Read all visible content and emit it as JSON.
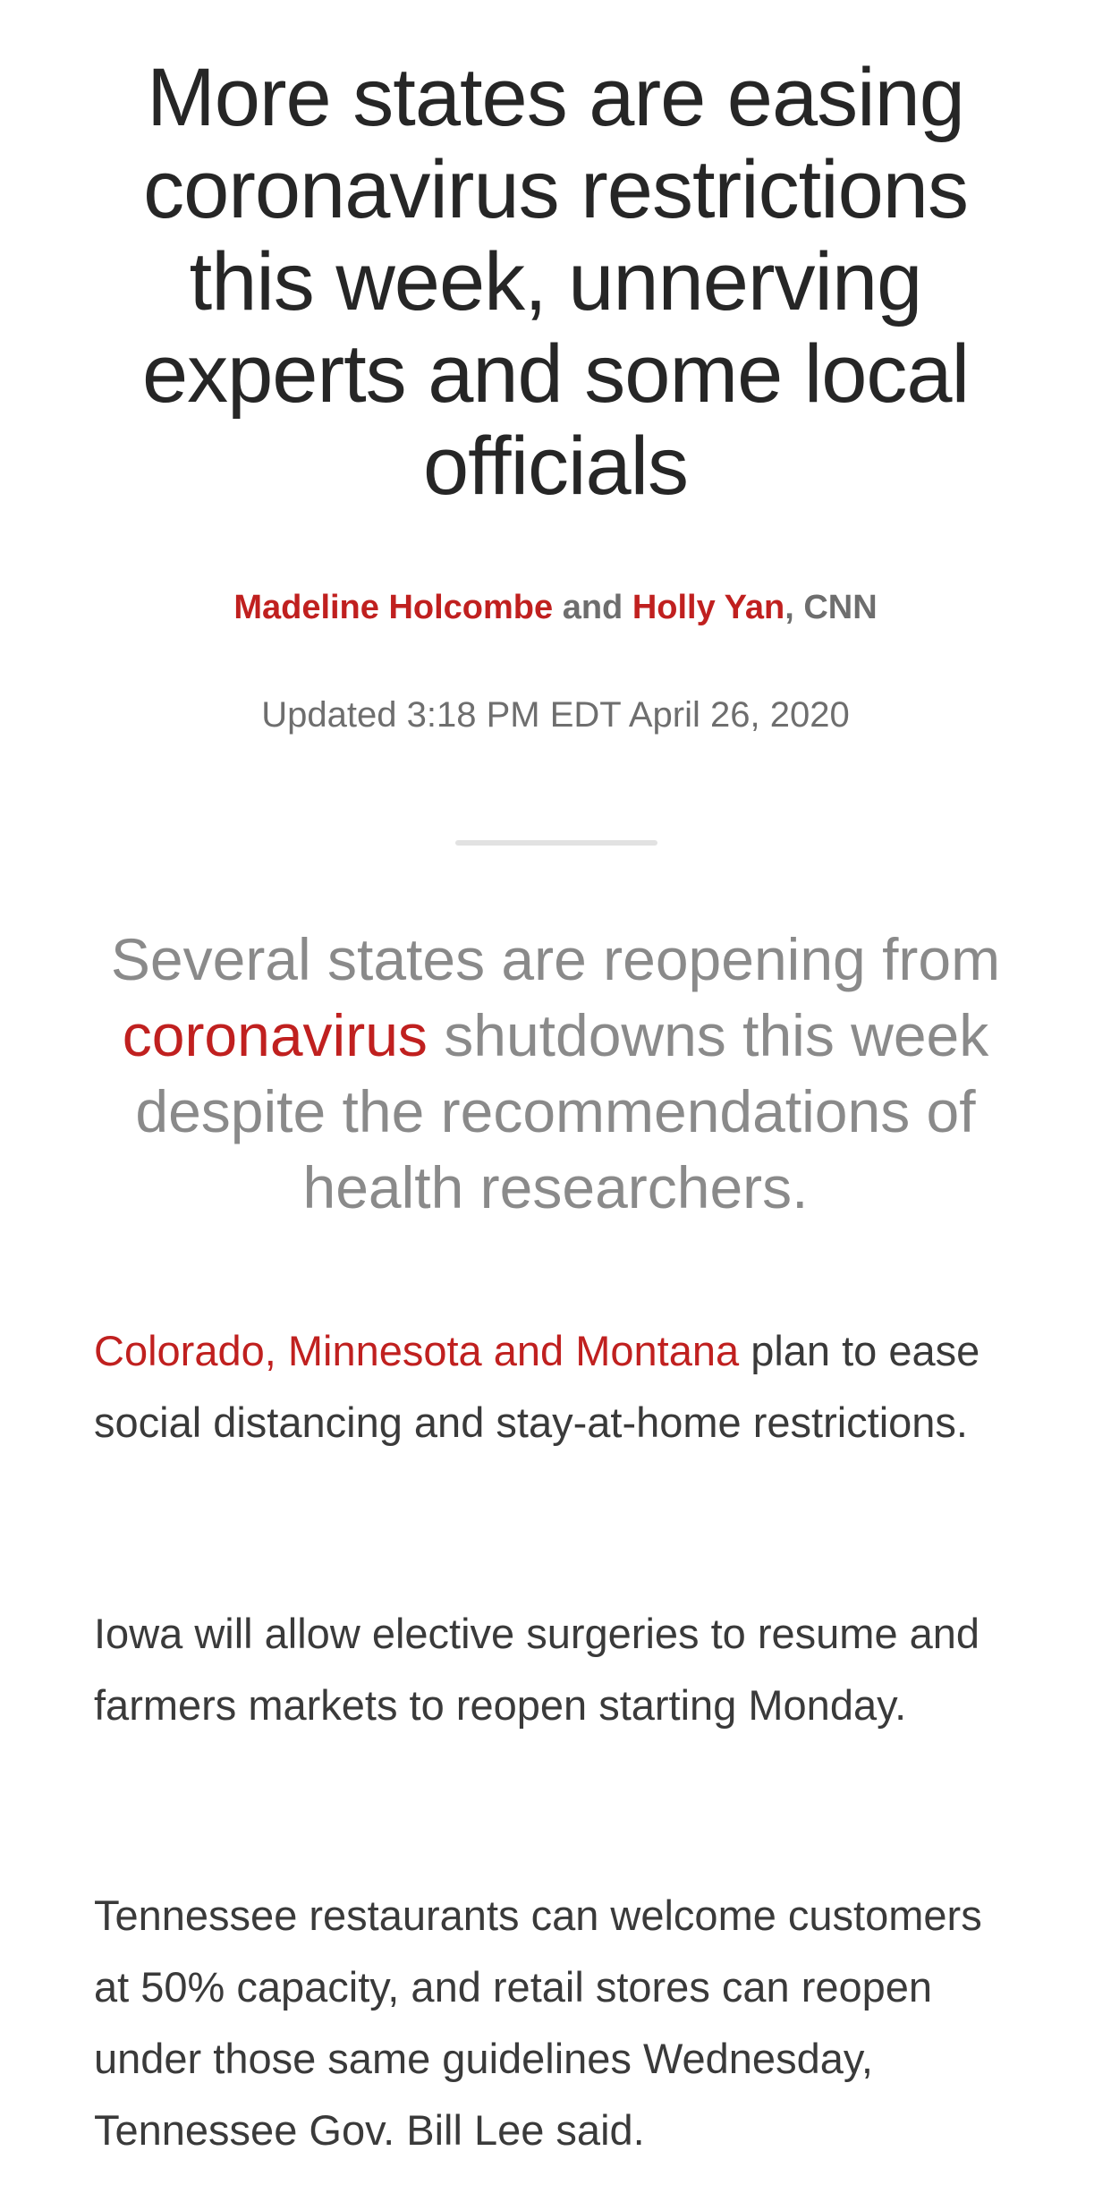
{
  "article": {
    "headline": "More states are easing coronavirus restrictions this week, unnerving experts and some local officials",
    "byline": {
      "author1": "Madeline Holcombe",
      "joiner": " and ",
      "author2": "Holly Yan",
      "source": ", CNN"
    },
    "updated": "Updated 3:18 PM EDT April 26, 2020",
    "lede": {
      "before": "Several states are reopening from ",
      "link": "coronavirus",
      "after": " shutdowns this week despite the recommendations of health researchers."
    },
    "paragraphs": [
      {
        "link": "Colorado, Minnesota and Montana",
        "text": " plan to ease social distancing and stay-at-home restrictions."
      },
      {
        "text": "Iowa will allow elective surgeries to resume and farmers markets to reopen starting Monday."
      },
      {
        "text": "Tennessee restaurants can welcome customers at 50% capacity, and retail stores can reopen under those same guidelines Wednesday, Tennessee Gov. Bill Lee said."
      }
    ]
  },
  "colors": {
    "link": "#c0201f",
    "headline": "#262626",
    "meta": "#6e6e6e",
    "lede": "#8a8a8a",
    "body": "#3a3a3a",
    "divider": "#e2e2e2"
  }
}
